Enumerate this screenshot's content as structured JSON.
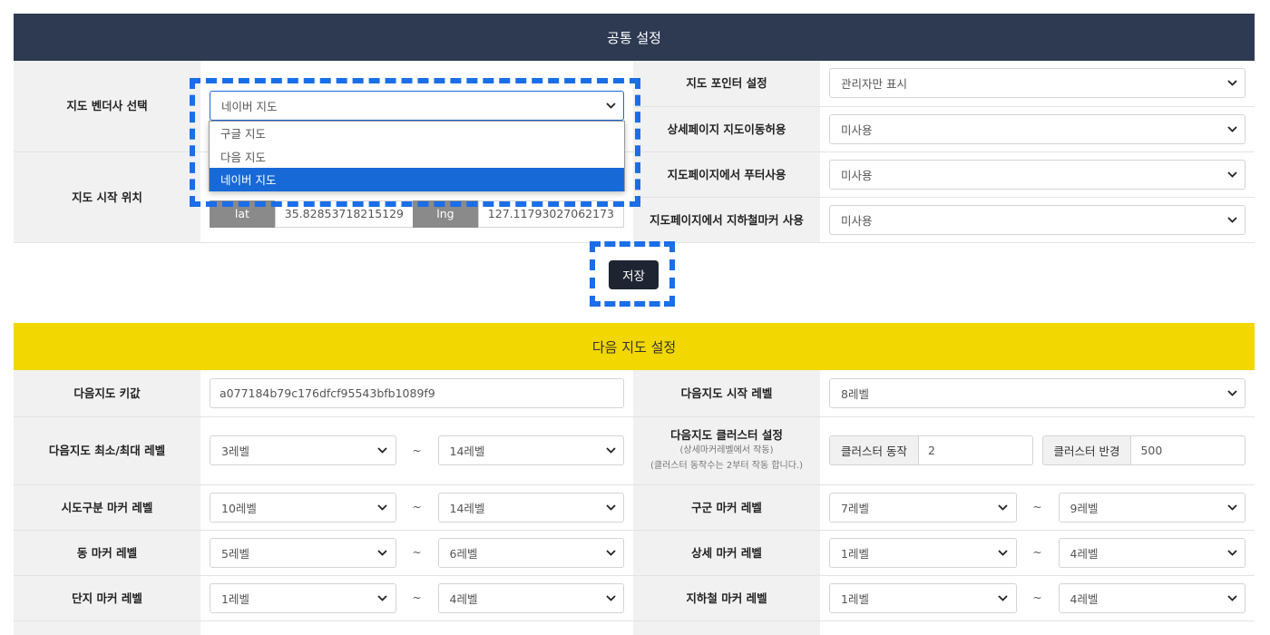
{
  "common": {
    "title": "공통 설정",
    "vendor_label": "지도 벤더사 선택",
    "vendor_value": "네이버 지도",
    "vendor_options": [
      "구글 지도",
      "다음 지도",
      "네이버 지도"
    ],
    "start_label": "지도 시작 위치",
    "lat_label": "lat",
    "lat_value": "35.82853718215129",
    "lng_label": "lng",
    "lng_value": "127.11793027062173",
    "pointer_label": "지도 포인터 설정",
    "pointer_value": "관리자만 표시",
    "detail_move_label": "상세페이지 지도이동허용",
    "detail_move_value": "미사용",
    "footer_label": "지도페이지에서 푸터사용",
    "footer_value": "미사용",
    "subway_label": "지도페이지에서 지하철마커 사용",
    "subway_value": "미사용",
    "save_label": "저장"
  },
  "daum": {
    "title": "다음 지도 설정",
    "key_label": "다음지도 키값",
    "key_value": "a077184b79c176dfcf95543bfb1089f9",
    "start_level_label": "다음지도 시작 레벨",
    "start_level_value": "8레벨",
    "minmax_label": "다음지도 최소/최대 레벨",
    "minmax_min": "3레벨",
    "minmax_max": "14레벨",
    "cluster_label": "다음지도 클러스터 설정",
    "cluster_sub1": "(상세마커레벨에서 작동)",
    "cluster_sub2": "(클러스터 동작수는 2부터 작동 합니다.)",
    "cluster_action_label": "클러스터 동작",
    "cluster_action_value": "2",
    "cluster_radius_label": "클러스터 반경",
    "cluster_radius_value": "500",
    "sido_label": "시도구분 마커 레벨",
    "sido_min": "10레벨",
    "sido_max": "14레벨",
    "gugun_label": "구군 마커 레벨",
    "gugun_min": "7레벨",
    "gugun_max": "9레벨",
    "dong_label": "동 마커 레벨",
    "dong_min": "5레벨",
    "dong_max": "6레벨",
    "detail_label": "상세 마커 레벨",
    "detail_min": "1레벨",
    "detail_max": "4레벨",
    "danji_label": "단지 마커 레벨",
    "danji_min": "1레벨",
    "danji_max": "4레벨",
    "subway_label": "지하철 마커 레벨",
    "subway_min": "1레벨",
    "subway_max": "4레벨",
    "tilde": "~"
  },
  "colors": {
    "header_dark": "#2d3a52",
    "header_yellow": "#f2d700",
    "highlight": "#1a6ee8",
    "selected_option": "#1769d8"
  },
  "icons": {
    "select_arrow": "chevron-down-icon"
  }
}
